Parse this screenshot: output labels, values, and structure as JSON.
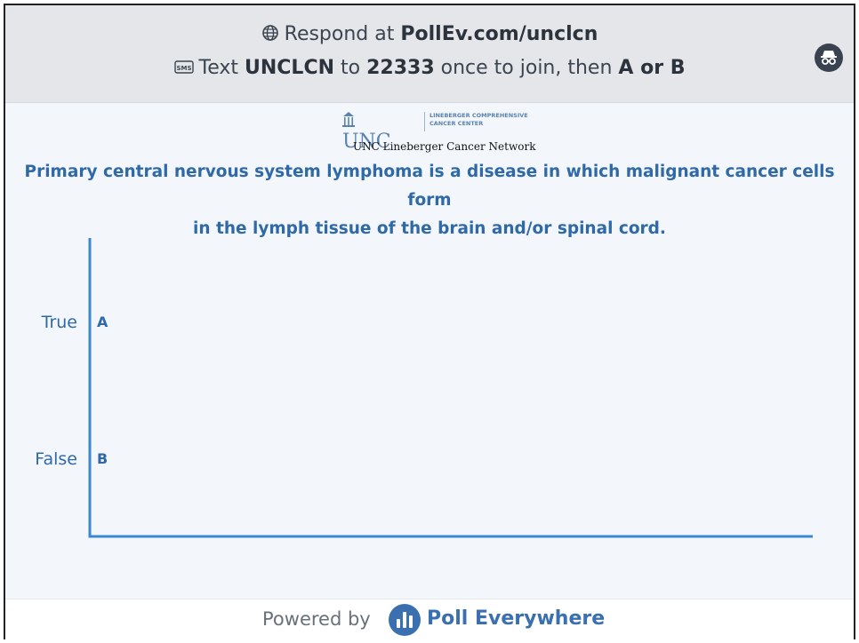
{
  "header": {
    "line1_prefix": "Respond at",
    "line1_url": "PollEv.com/unclcn",
    "line2_prefix": "Text",
    "line2_keyword": "UNCLCN",
    "line2_to": "to",
    "line2_number": "22333",
    "line2_mid": "once to join, then",
    "line2_options": "A or B",
    "sms_icon_text": "SMS"
  },
  "logo": {
    "unc": "UNC",
    "center_line1": "LINEBERGER COMPREHENSIVE",
    "center_line2": "CANCER CENTER",
    "network": "UNC Lineberger Cancer Network"
  },
  "question": {
    "line1": "Primary central nervous system lymphoma is a disease in which malignant cancer cells form",
    "line2": "in the lymph tissue of the brain and/or spinal cord."
  },
  "chart_data": {
    "type": "bar",
    "orientation": "horizontal",
    "categories": [
      "True",
      "False"
    ],
    "letters": [
      "A",
      "B"
    ],
    "values": [
      0,
      0
    ],
    "axis_color": "#3b87d4",
    "label_color": "#2f69a8"
  },
  "footer": {
    "powered_by": "Powered by",
    "brand": "Poll Everywhere"
  },
  "colors": {
    "accent": "#2f69a8",
    "header_bg": "#e4e6ea",
    "body_bg": "#f3f7fb"
  },
  "icons": {
    "globe": "globe-icon",
    "sms": "sms-icon",
    "incognito": "incognito-icon",
    "poll_everywhere": "poll-everywhere-logo-icon"
  }
}
